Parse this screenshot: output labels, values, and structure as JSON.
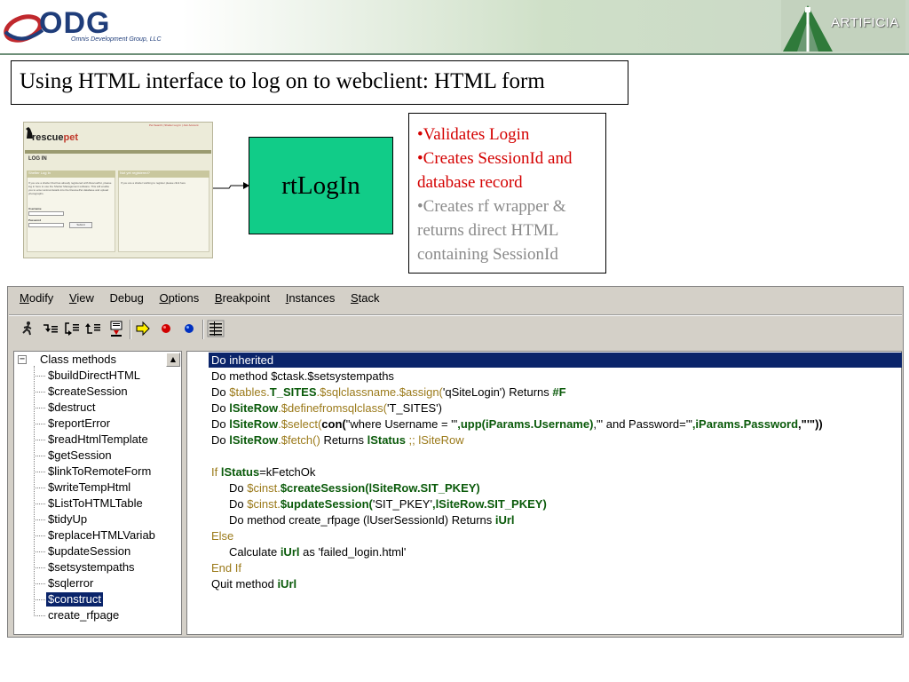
{
  "header": {
    "odg_logo_text": "ODG",
    "odg_tagline": "Omnis Development Group, LLC",
    "artificia_logo_text": "ARTIFICIA"
  },
  "title": "Using HTML interface to log on to webclient: HTML form",
  "thumbnail": {
    "logo_part1": "rescue",
    "logo_part2": "pet",
    "top_links": "Pet Search | Shelter Log In | Join Account",
    "section": "LOG IN",
    "left_heading": "Shelter Log In",
    "left_body": "If you are a shelter that has already registered with RescuePet, please log in here to use the Shelter Management software. This will enable you to enter animal details into the RescuePet database and upload photographs.",
    "right_heading": "Not yet registered?",
    "right_body": "If you are a shelter wishing to register please click here",
    "username_label": "Username",
    "password_label": "Password",
    "submit_label": "Submit"
  },
  "process_box": "rtLogIn",
  "notes": [
    {
      "text": "•Validates Login",
      "color": "#d40000"
    },
    {
      "text": "•Creates SessionId and database record",
      "color": "#d40000"
    },
    {
      "text": "•Creates rf wrapper & returns direct HTML containing SessionId",
      "color": "#8a8a8a"
    }
  ],
  "ide": {
    "menu": [
      {
        "label": "Modify",
        "mnemonic": "M"
      },
      {
        "label": "View",
        "mnemonic": "V"
      },
      {
        "label": "Debug",
        "mnemonic": "g"
      },
      {
        "label": "Options",
        "mnemonic": "O"
      },
      {
        "label": "Breakpoint",
        "mnemonic": "B"
      },
      {
        "label": "Instances",
        "mnemonic": "I"
      },
      {
        "label": "Stack",
        "mnemonic": "S"
      }
    ],
    "toolbar_icons": [
      "run-icon",
      "step-into-icon",
      "step-over-icon",
      "step-out-icon",
      "trace-icon",
      "go-to-icon",
      "breakpoint-red-icon",
      "breakpoint-blue-icon",
      "watch-list-icon"
    ],
    "tree": {
      "root": "Class methods",
      "items": [
        "$buildDirectHTML",
        "$createSession",
        "$destruct",
        "$reportError",
        "$readHtmlTemplate",
        "$getSession",
        "$linkToRemoteForm",
        "$writeTempHtml",
        "$ListToHTMLTable",
        "$tidyUp",
        "$replaceHTMLVariab",
        "$updateSession",
        "$setsystempaths",
        "$sqlerror",
        "$construct",
        "create_rfpage"
      ],
      "selected": "$construct"
    },
    "code": {
      "l1": "Do inherited",
      "l2": "Do method $ctask.$setsystempaths",
      "l3a": "Do ",
      "l3b": "$tables.",
      "l3c": "T_SITES",
      "l3d": ".$sqlclassname.$assign(",
      "l3e": "'qSiteLogin'",
      "l3f": ") Returns ",
      "l3g": "#F",
      "l4a": "Do ",
      "l4b": "lSiteRow",
      "l4c": ".$definefromsqlclass(",
      "l4d": "'T_SITES'",
      "l4e": ")",
      "l5a": "Do ",
      "l5b": "lSiteRow",
      "l5c": ".$select(",
      "l5d": "con(",
      "l5e": "\"where Username = '\"",
      "l5f": ",upp(iParams.Username)",
      "l5g": ",\"' and Password='\"",
      "l5h": ",iParams.Password",
      "l5i": ",\"'\"))",
      "l6a": "Do ",
      "l6b": "lSiteRow",
      "l6c": ".$fetch()",
      "l6d": " Returns ",
      "l6e": "lStatus",
      "l6f": "     ;; lSiteRow",
      "l7a": "If ",
      "l7b": "lStatus",
      "l7c": "=kFetchOk",
      "l8a": "Do ",
      "l8b": "$cinst.",
      "l8c": "$createSession(lSiteRow.SIT_PKEY)",
      "l9a": "Do ",
      "l9b": "$cinst.",
      "l9c": "$updateSession(",
      "l9d": "'SIT_PKEY'",
      "l9e": ",lSiteRow.SIT_PKEY)",
      "l10a": "Do method create_rfpage (lUserSessionId) Returns ",
      "l10b": "iUrl",
      "l11": "Else",
      "l12a": "Calculate ",
      "l12b": "iUrl",
      "l12c": " as ",
      "l12d": "'failed_login.html'",
      "l13": "End If",
      "l14a": "Quit method ",
      "l14b": "iUrl"
    }
  }
}
